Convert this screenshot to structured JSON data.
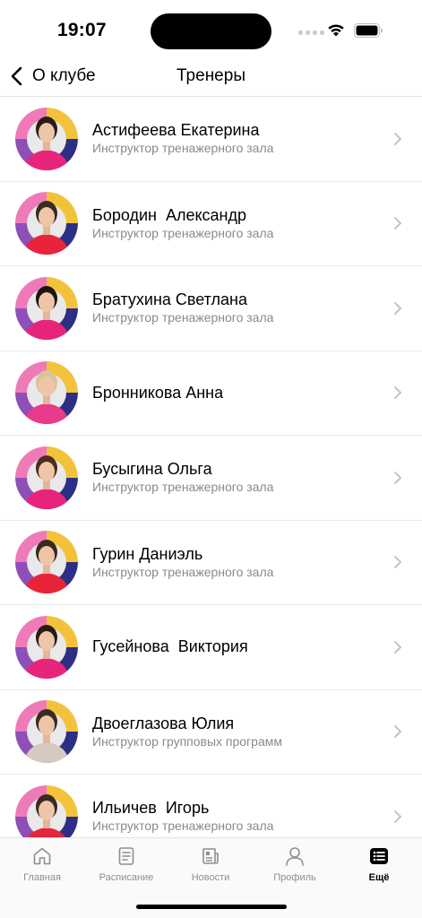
{
  "status_bar": {
    "time": "19:07"
  },
  "nav": {
    "back_label": "О клубе",
    "title": "Тренеры"
  },
  "trainers": [
    {
      "name": "Астифеева Екатерина",
      "role": "Инструктор тренажерного зала",
      "shirt_color": "#e8247a",
      "hair_color": "#2a1d18"
    },
    {
      "name": "Бородин  Александр",
      "role": "Инструктор тренажерного зала",
      "shirt_color": "#e8243a",
      "hair_color": "#3b2a20"
    },
    {
      "name": "Братухина Светлана",
      "role": "Инструктор тренажерного зала",
      "shirt_color": "#e8247a",
      "hair_color": "#1c1512"
    },
    {
      "name": "Бронникова Анна",
      "role": "",
      "shirt_color": "#ea3a8a",
      "hair_color": "#d9c49a"
    },
    {
      "name": "Бусыгина Ольга",
      "role": "Инструктор тренажерного зала",
      "shirt_color": "#e8247a",
      "hair_color": "#4a2e20"
    },
    {
      "name": "Гурин Даниэль",
      "role": "Инструктор тренажерного зала",
      "shirt_color": "#e8243a",
      "hair_color": "#3a2a20"
    },
    {
      "name": "Гусейнова  Виктория",
      "role": "",
      "shirt_color": "#e8247a",
      "hair_color": "#2a1a12"
    },
    {
      "name": "Двоеглазова Юлия",
      "role": "Инструктор групповых программ",
      "shirt_color": "#d6c9c0",
      "hair_color": "#3a2a22"
    },
    {
      "name": "Ильичев  Игорь",
      "role": "Инструктор тренажерного зала",
      "shirt_color": "#e8243a",
      "hair_color": "#3a2a20"
    }
  ],
  "tab_bar": {
    "tabs": [
      {
        "label": "Главная",
        "icon": "home-icon"
      },
      {
        "label": "Расписание",
        "icon": "schedule-icon"
      },
      {
        "label": "Новости",
        "icon": "news-icon"
      },
      {
        "label": "Профиль",
        "icon": "profile-icon"
      },
      {
        "label": "Ещё",
        "icon": "more-icon",
        "active": true
      }
    ]
  },
  "colors": {
    "accent": "#000000",
    "inactive": "#8e8e93",
    "subtitle": "#8a8a8a"
  }
}
